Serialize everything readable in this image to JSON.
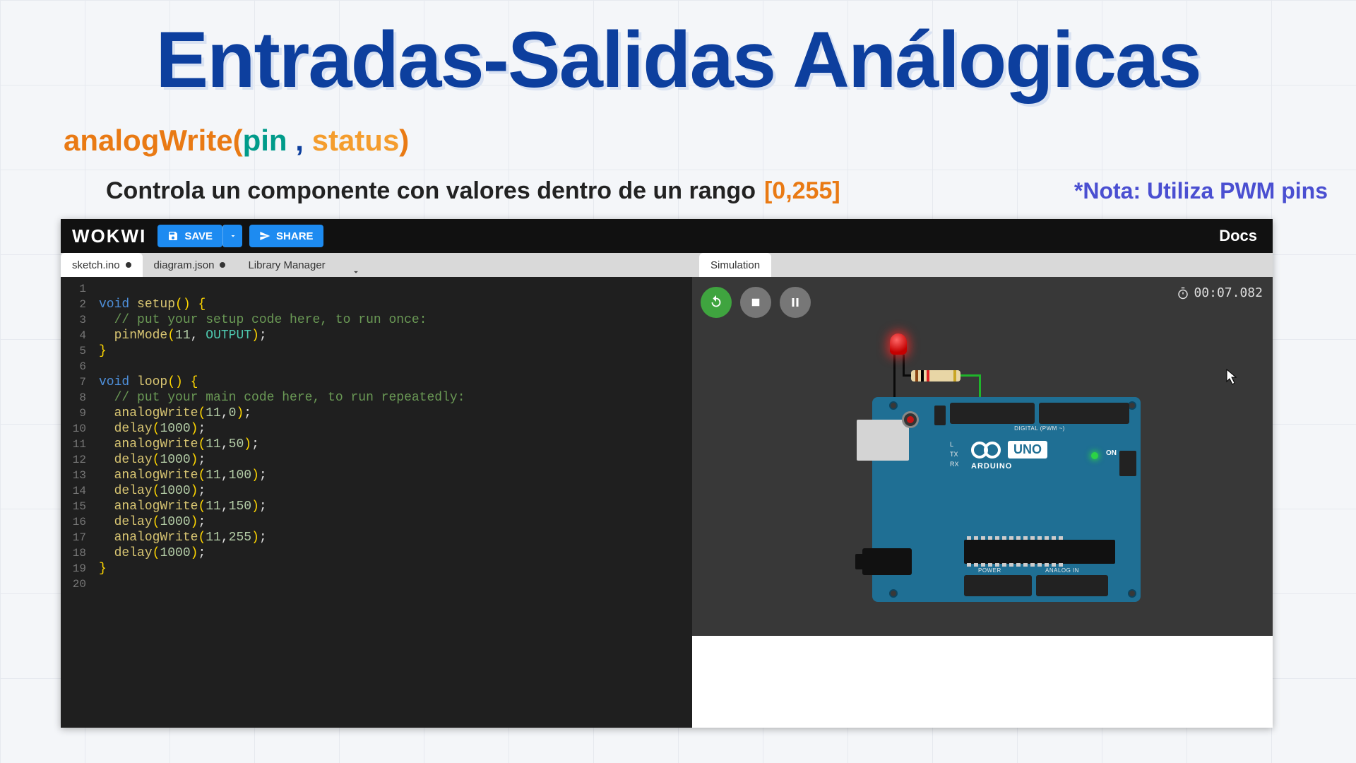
{
  "slide": {
    "title": "Entradas-Salidas Análogicas",
    "syntax": {
      "fn_open": "analogWrite(",
      "pin": "pin",
      "comma": " , ",
      "status": "status",
      "close": ")"
    },
    "description": "Controla un componente con valores dentro de un rango",
    "range": "[0,255]",
    "note": "*Nota: Utiliza PWM pins"
  },
  "ide": {
    "brand": "WOKWI",
    "save": "SAVE",
    "share": "SHARE",
    "docs": "Docs",
    "tabs": [
      {
        "label": "sketch.ino",
        "dirty": true,
        "active": true
      },
      {
        "label": "diagram.json",
        "dirty": true,
        "active": false
      },
      {
        "label": "Library Manager",
        "dirty": false,
        "active": false
      }
    ]
  },
  "code": {
    "lines": [
      {
        "n": "1",
        "html": ""
      },
      {
        "n": "2",
        "html": "<span class='kw'>void</span> <span class='fn2'>setup</span><span class='paren'>()</span> <span class='paren'>{</span>"
      },
      {
        "n": "3",
        "html": "  <span class='comment'>// put your setup code here, to run once:</span>"
      },
      {
        "n": "4",
        "html": "  <span class='fn2'>pinMode</span><span class='paren'>(</span><span class='num'>11</span>, <span class='const'>OUTPUT</span><span class='paren'>)</span>;"
      },
      {
        "n": "5",
        "html": "<span class='paren'>}</span>"
      },
      {
        "n": "6",
        "html": ""
      },
      {
        "n": "7",
        "html": "<span class='kw'>void</span> <span class='fn2'>loop</span><span class='paren'>()</span> <span class='paren'>{</span>"
      },
      {
        "n": "8",
        "html": "  <span class='comment'>// put your main code here, to run repeatedly:</span>"
      },
      {
        "n": "9",
        "html": "  <span class='fn2'>analogWrite</span><span class='paren'>(</span><span class='num'>11</span>,<span class='num'>0</span><span class='paren'>)</span>;"
      },
      {
        "n": "10",
        "html": "  <span class='fn2'>delay</span><span class='paren'>(</span><span class='num'>1000</span><span class='paren'>)</span>;"
      },
      {
        "n": "11",
        "html": "  <span class='fn2'>analogWrite</span><span class='paren'>(</span><span class='num'>11</span>,<span class='num'>50</span><span class='paren'>)</span>;"
      },
      {
        "n": "12",
        "html": "  <span class='fn2'>delay</span><span class='paren'>(</span><span class='num'>1000</span><span class='paren'>)</span>;"
      },
      {
        "n": "13",
        "html": "  <span class='fn2'>analogWrite</span><span class='paren'>(</span><span class='num'>11</span>,<span class='num'>100</span><span class='paren'>)</span>;"
      },
      {
        "n": "14",
        "html": "  <span class='fn2'>delay</span><span class='paren'>(</span><span class='num'>1000</span><span class='paren'>)</span>;"
      },
      {
        "n": "15",
        "html": "  <span class='fn2'>analogWrite</span><span class='paren'>(</span><span class='num'>11</span>,<span class='num'>150</span><span class='paren'>)</span>;"
      },
      {
        "n": "16",
        "html": "  <span class='fn2'>delay</span><span class='paren'>(</span><span class='num'>1000</span><span class='paren'>)</span>;"
      },
      {
        "n": "17",
        "html": "  <span class='fn2'>analogWrite</span><span class='paren'>(</span><span class='num'>11</span>,<span class='num'>255</span><span class='paren'>)</span>;"
      },
      {
        "n": "18",
        "html": "  <span class='fn2'>delay</span><span class='paren'>(</span><span class='num'>1000</span><span class='paren'>)</span>;"
      },
      {
        "n": "19",
        "html": "<span class='paren'>}</span>"
      },
      {
        "n": "20",
        "html": ""
      }
    ]
  },
  "sim": {
    "tab": "Simulation",
    "timer": "00:07.082",
    "arduino_text": "ARDUINO",
    "uno": "UNO",
    "on": "ON",
    "digital_label": "DIGITAL (PWM ~)",
    "power_label": "POWER",
    "analog_label": "ANALOG IN",
    "tx": "TX",
    "rx": "RX",
    "l": "L"
  }
}
